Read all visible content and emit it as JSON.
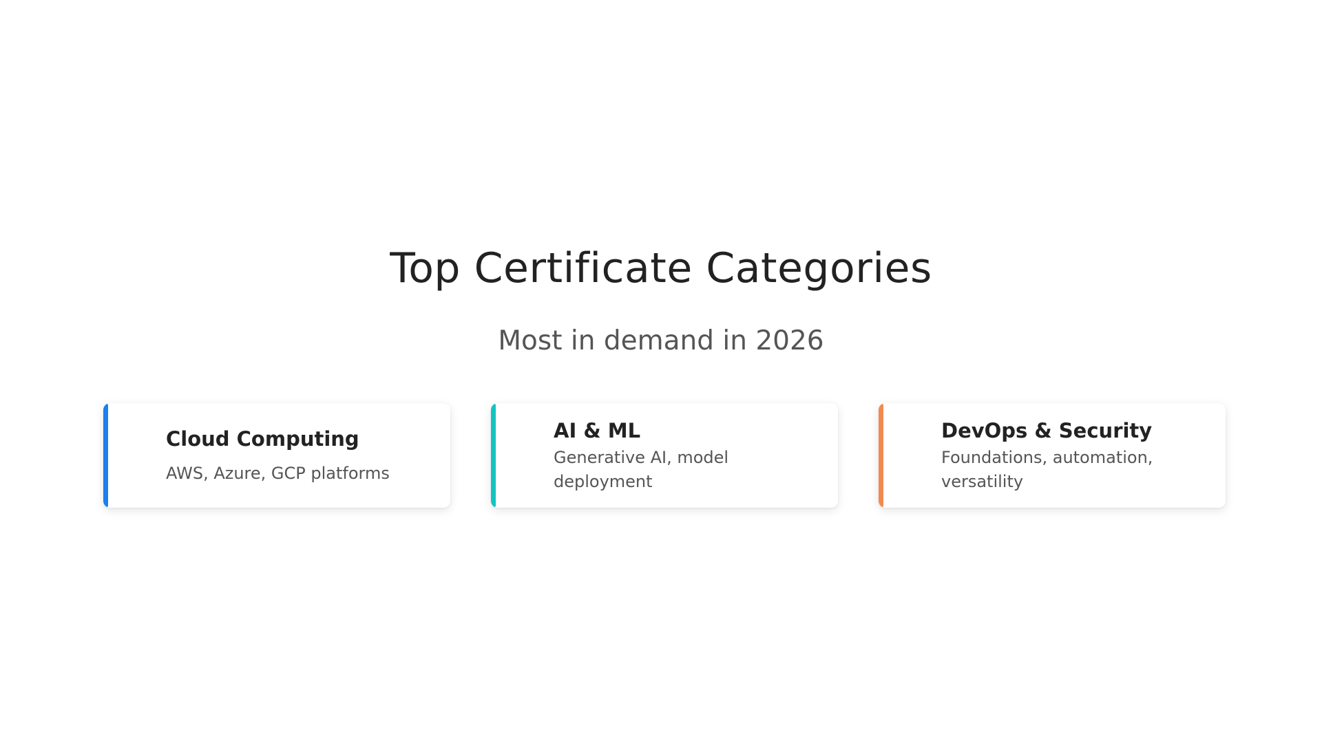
{
  "header": {
    "title": "Top Certificate Categories",
    "subtitle": "Most in demand in 2026"
  },
  "cards": [
    {
      "title": "Cloud Computing",
      "description": "AWS, Azure, GCP platforms",
      "accent_color": "#1a7ff0"
    },
    {
      "title": "AI & ML",
      "description": "Generative AI, model deployment",
      "accent_color": "#14c3c0"
    },
    {
      "title": "DevOps & Security",
      "description": "Foundations, automation, versatility",
      "accent_color": "#f08a50"
    }
  ]
}
